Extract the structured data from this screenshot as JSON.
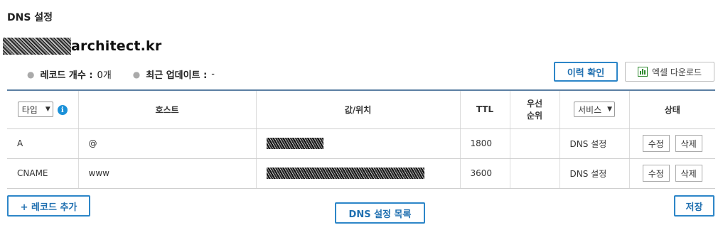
{
  "page": {
    "title": "DNS 설정"
  },
  "domain": {
    "name_visible": "architect.kr"
  },
  "summary": {
    "record_count_label": "레코드 개수 :",
    "record_count_value": "0개",
    "last_update_label": "최근 업데이트 :",
    "last_update_value": "-"
  },
  "actions": {
    "history_label": "이력 확인",
    "excel_label": "엑셀 다운로드"
  },
  "table": {
    "type_select": "타입",
    "info": "i",
    "headers": {
      "host": "호스트",
      "value": "값/위치",
      "ttl": "TTL",
      "priority_line1": "우선",
      "priority_line2": "순위",
      "service_select": "서비스",
      "status": "상태"
    },
    "rows": [
      {
        "type": "A",
        "host": "@",
        "ttl": "1800",
        "priority": "",
        "service": "DNS 설정",
        "edit": "수정",
        "delete": "삭제"
      },
      {
        "type": "CNAME",
        "host": "www",
        "ttl": "3600",
        "priority": "",
        "service": "DNS 설정",
        "edit": "수정",
        "delete": "삭제"
      }
    ]
  },
  "footer": {
    "add_label": "+ 레코드 추가",
    "dns_list_label": "DNS 설정 목록",
    "save_label": "저장"
  },
  "colors": {
    "accent": "#2d86c8",
    "table_top_border": "#5b7fa3",
    "info": "#1a90d8",
    "excel": "#2f8a2f"
  }
}
